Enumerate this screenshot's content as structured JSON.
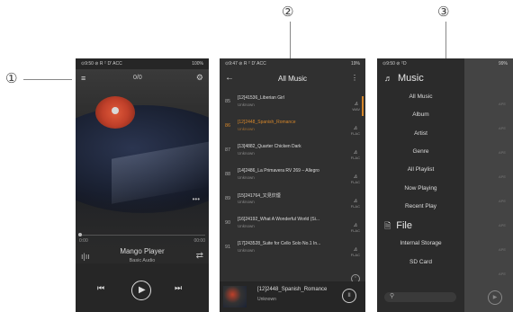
{
  "callouts": {
    "one": "①",
    "two": "②",
    "three": "③"
  },
  "phone1": {
    "status_left": "⊙9:50 ⊘ R ᵀ D' ACC",
    "status_right": "100%",
    "menu_icon": "≡",
    "count": "0/0",
    "gear_icon": "⚙",
    "more_icon": "•••",
    "time_start": "0:00",
    "time_end": "00:00",
    "title": "Mango Player",
    "subtitle": "Basic Audio",
    "eq_icon": "ı|ıı",
    "shuffle_icon": "⇄",
    "prev_icon": "⏮",
    "play_icon": "▶",
    "next_icon": "⏭",
    "progress": 0
  },
  "phone2": {
    "status_left": "⊙9:47 ⊘ R ᵀ D' ACC",
    "status_right": "19%",
    "back_icon": "←",
    "title": "All Music",
    "more_icon": "⋮",
    "rows": [
      {
        "num": "85",
        "name": "[12]41536_Liberian Girl",
        "artist": "Unknown",
        "fmt": "WAV"
      },
      {
        "num": "86",
        "name": "[12]2448_Spanish_Romance",
        "artist": "Unknown",
        "fmt": "FLAC"
      },
      {
        "num": "87",
        "name": "[13]4882_Quarter Chicken Dark",
        "artist": "Unknown",
        "fmt": "FLAC"
      },
      {
        "num": "88",
        "name": "[14]2486_La Primavera RV 269 – Allegro",
        "artist": "Unknown",
        "fmt": "FLAC"
      },
      {
        "num": "89",
        "name": "[15]241764_又見炊煙",
        "artist": "Unknown",
        "fmt": "FLAC"
      },
      {
        "num": "90",
        "name": "[16]24192_What A Wonderful World (Si...",
        "artist": "Unknown",
        "fmt": "FLAC"
      },
      {
        "num": "91",
        "name": "[17]243528_Suite for Cello Solo No.1 In...",
        "artist": "Unknown",
        "fmt": "FLAC"
      }
    ],
    "now_title": "[12]2448_Spanish_Romance",
    "now_artist": "Unknown",
    "pause_icon": "II"
  },
  "phone3": {
    "status_left": "⊙9:50 ⊘ ᵀD",
    "status_right": "99%",
    "music_head": "Music",
    "music_icon": "♬",
    "items": [
      "All Music",
      "Album",
      "Artist",
      "Genre",
      "All Playlist",
      "Now Playing",
      "Recent Play"
    ],
    "file_head": "File",
    "file_icon": "🗎",
    "file_items": [
      "Internal Storage",
      "SD Card"
    ],
    "search_icon": "⚲",
    "play_icon": "▶",
    "side_fmt": "APE"
  }
}
